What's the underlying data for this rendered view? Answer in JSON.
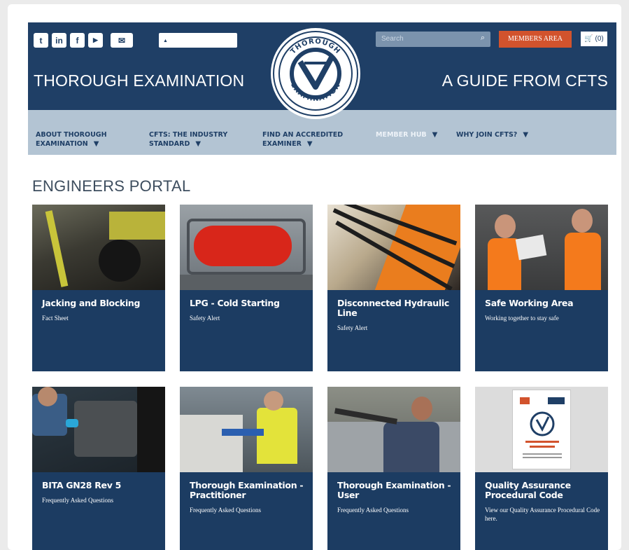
{
  "header": {
    "social": [
      {
        "icon": "twitter-icon",
        "glyph": "t"
      },
      {
        "icon": "linkedin-icon",
        "glyph": "in"
      },
      {
        "icon": "facebook-icon",
        "glyph": "f"
      },
      {
        "icon": "youtube-icon",
        "glyph": "▶"
      },
      {
        "icon": "email-icon",
        "glyph": "✉"
      }
    ],
    "login_glyph": "▲",
    "brand_left": "THOROUGH EXAMINATION",
    "brand_right": "A GUIDE FROM CFTS",
    "search_placeholder": "Search",
    "search_icon": "⌕",
    "members_label": "MEMBERS AREA",
    "cart_label": "🛒 (0)",
    "logo_text_top": "THOROUGH",
    "logo_text_bottom": "EXAMINATION"
  },
  "nav": [
    {
      "line1": "ABOUT THOROUGH",
      "line2": "EXAMINATION"
    },
    {
      "line1": "CFTS: THE INDUSTRY",
      "line2": "STANDARD"
    },
    {
      "line1": "FIND AN ACCREDITED",
      "line2": "EXAMINER"
    },
    {
      "line1": "MEMBER HUB",
      "line2": ""
    },
    {
      "line1": "WHY JOIN CFTS?",
      "line2": ""
    }
  ],
  "portal_title": "ENGINEERS PORTAL",
  "tiles": [
    {
      "title": "Jacking and Blocking",
      "subtitle": "Fact Sheet"
    },
    {
      "title": "LPG - Cold Starting",
      "subtitle": "Safety Alert"
    },
    {
      "title": "Disconnected Hydraulic Line",
      "subtitle": "Safety Alert"
    },
    {
      "title": "Safe Working Area",
      "subtitle": "Working together to stay safe"
    },
    {
      "title": "BITA GN28 Rev 5",
      "subtitle": "Frequently Asked Questions"
    },
    {
      "title": "Thorough Examination - Practitioner",
      "subtitle": "Frequently Asked Questions"
    },
    {
      "title": "Thorough Examination - User",
      "subtitle": "Frequently Asked Questions"
    },
    {
      "title": "Quality Assurance Procedural Code",
      "subtitle": "View our Quality Assurance Procedural Code here."
    }
  ],
  "colors": {
    "navy": "#1f3f66",
    "nav_bg": "#b3c4d3",
    "accent": "#d2532d"
  }
}
